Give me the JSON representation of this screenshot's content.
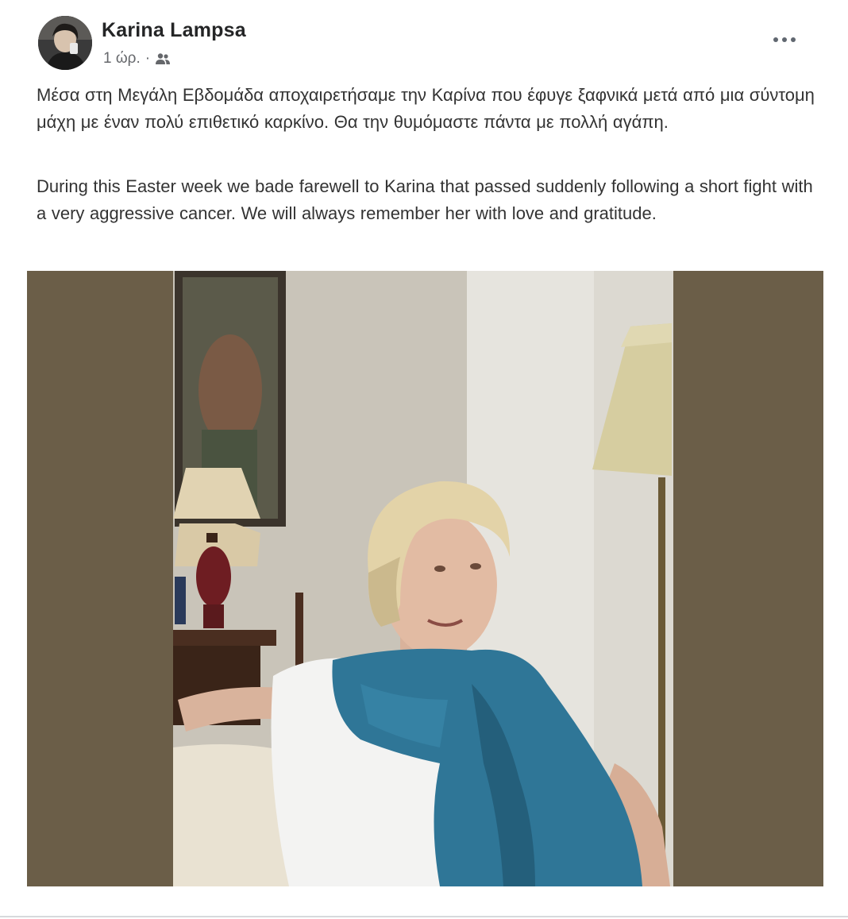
{
  "post": {
    "author": {
      "name": "Karina Lampsa",
      "avatar_icon": "profile-photo"
    },
    "timestamp": "1 ώρ.",
    "separator": "·",
    "audience_icon": "friends-icon",
    "menu_icon": "more-options-icon",
    "text_greek": "Μέσα  στη Μεγάλη Εβδομάδα αποχαιρετήσαμε την Καρίνα που έφυγε ξαφνικά μετά από μια σύντομη μάχη με έναν πολύ επιθετικό καρκίνο. Θα την θυμόμαστε πάντα με πολλή αγάπη.",
    "text_english": "During this Easter week we bade farewell to Karina that passed suddenly following a short fight with a very aggressive cancer. We will always remember her with love and gratitude.",
    "photo_icon": "portrait-photo"
  },
  "colors": {
    "photo_border": "#6b5e48",
    "scarf": "#2f7697",
    "text": "#333333",
    "meta": "#65676b"
  }
}
